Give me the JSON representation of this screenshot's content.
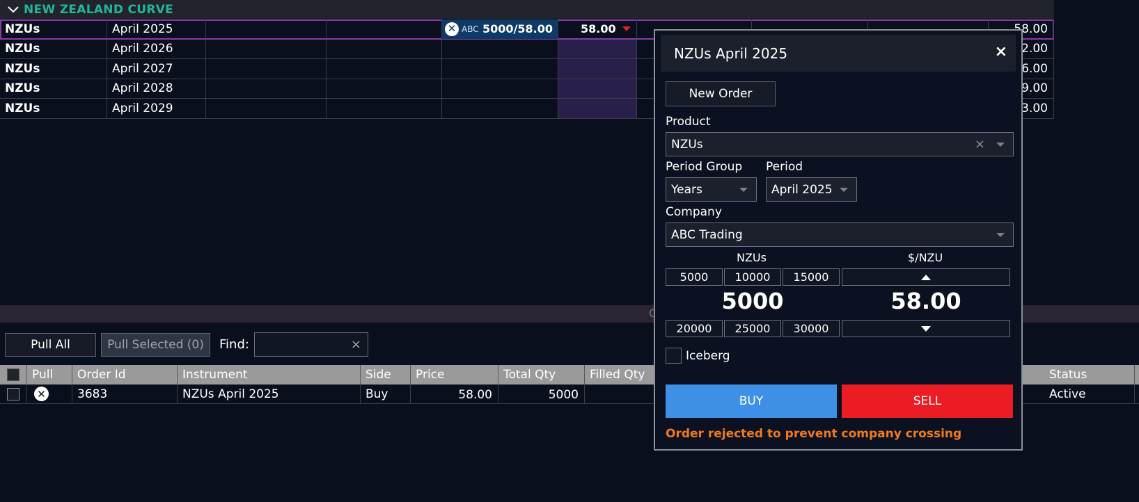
{
  "curve": {
    "title": "NEW ZEALAND CURVE",
    "rows": [
      {
        "product": "NZUs",
        "period": "April 2025",
        "bid_company": "ABC",
        "bid_qty": "5000/58.00",
        "mid": "58.00",
        "last": "58.00"
      },
      {
        "product": "NZUs",
        "period": "April 2026",
        "last": "2.00"
      },
      {
        "product": "NZUs",
        "period": "April 2027",
        "last": "6.00"
      },
      {
        "product": "NZUs",
        "period": "April 2028",
        "last": "9.00"
      },
      {
        "product": "NZUs",
        "period": "April 2029",
        "last": "3.00"
      }
    ]
  },
  "orders_section": {
    "collapsed_label": "O",
    "pull_all": "Pull All",
    "pull_selected": "Pull Selected (0)",
    "find_label": "Find:",
    "find_value": "",
    "clear_glyph": "×",
    "columns": [
      "Pull",
      "Order Id",
      "Instrument",
      "Side",
      "Price",
      "Total Qty",
      "Filled Qty",
      "Status"
    ],
    "rows": [
      {
        "order_id": "3683",
        "instrument": "NZUs April 2025",
        "side": "Buy",
        "price": "58.00",
        "total_qty": "5000",
        "filled_qty": "",
        "status": "Active"
      }
    ]
  },
  "dialog": {
    "title": "NZUs April 2025",
    "close": "×",
    "new_order": "New Order",
    "product_label": "Product",
    "product_value": "NZUs",
    "period_group_label": "Period Group",
    "period_group_value": "Years",
    "period_label": "Period",
    "period_value": "April 2025",
    "company_label": "Company",
    "company_value": "ABC Trading",
    "qty_header": "NZUs",
    "price_header": "$/NZU",
    "qty_presets_top": [
      "5000",
      "10000",
      "15000"
    ],
    "qty_presets_bottom": [
      "20000",
      "25000",
      "30000"
    ],
    "qty_value": "5000",
    "price_value": "58.00",
    "iceberg_label": "Iceberg",
    "buy": "BUY",
    "sell": "SELL",
    "error": "Order rejected to prevent company crossing"
  },
  "colors": {
    "background": "#0a0f1e",
    "curve_title": "#25b59b",
    "selected_outline": "#8a3aa8",
    "bid_cell": "#0d3a66",
    "buy": "#3e8fe6",
    "sell": "#eb1c24",
    "error": "#f07a1e"
  },
  "icons": [
    "chevron-down-icon",
    "cancel-circle-icon",
    "close-icon",
    "dropdown-caret-icon",
    "price-up-arrow-icon",
    "price-down-arrow-icon",
    "down-triangle-icon"
  ]
}
